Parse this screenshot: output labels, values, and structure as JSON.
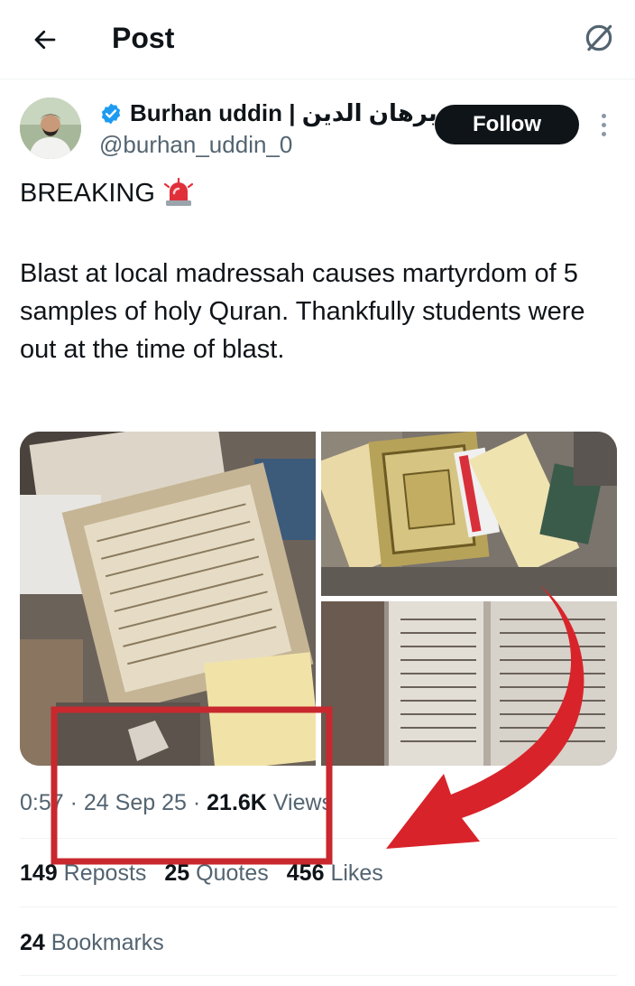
{
  "header": {
    "title": "Post",
    "back_icon": "arrow-left-icon",
    "action_icon": "no-sign-icon"
  },
  "author": {
    "display_name": "Burhan uddin | برهان الدين",
    "handle": "@burhan_uddin_0",
    "verified": true,
    "follow_label": "Follow"
  },
  "post": {
    "headline": "BREAKING",
    "headline_emoji": "siren-icon",
    "body": "Blast at local madressah causes martyrdom of 5 samples of holy Quran. Thankfully students were out at the time of blast."
  },
  "media": {
    "count": 3,
    "items": [
      "damaged-quran-pages-photo",
      "damaged-quran-book-photo",
      "open-damaged-book-photo"
    ]
  },
  "meta": {
    "time": "0:57",
    "date": "24 Sep 25",
    "views_count": "21.6K",
    "views_label": "Views"
  },
  "stats": {
    "reposts_count": "149",
    "reposts_label": "Reposts",
    "quotes_count": "25",
    "quotes_label": "Quotes",
    "likes_count": "456",
    "likes_label": "Likes",
    "bookmarks_count": "24",
    "bookmarks_label": "Bookmarks"
  },
  "colors": {
    "text": "#0f1419",
    "secondary_text": "#536471",
    "verified": "#1d9bf0",
    "follow_bg": "#0f1419",
    "annotation": "#d8232a"
  }
}
